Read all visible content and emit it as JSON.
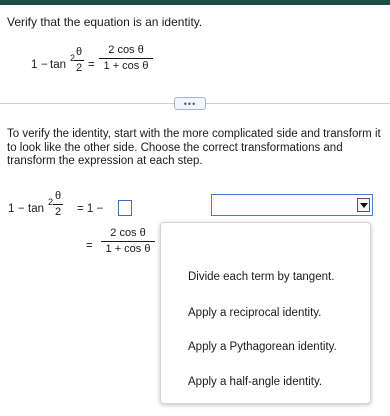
{
  "prompt": "Verify that the equation is an identity.",
  "equation": {
    "lhs_one": "1",
    "lhs_minus": "−",
    "lhs_tan": "tan",
    "lhs_exp": "2",
    "lhs_theta": "θ",
    "lhs_two": "2",
    "equals": "=",
    "rhs_num": "2 cos θ",
    "rhs_den": "1 + cos θ"
  },
  "more_button_label": "•••",
  "instructions": "To verify the identity, start with the more complicated side and transform it to look like the other side. Choose the correct transformations and transform the expression at each step.",
  "work": {
    "line1": {
      "one": "1",
      "minus": "−",
      "tan": "tan",
      "exp": "2",
      "theta": "θ",
      "two": "2",
      "equals_rhs": "= 1 −"
    },
    "line2": {
      "equals": "=",
      "num": "2 cos θ",
      "den": "1 + cos θ"
    }
  },
  "transformation_select": {
    "value": ""
  },
  "dropdown_options": [
    "Divide each term by tangent.",
    "Apply a reciprocal identity.",
    "Apply a Pythagorean identity.",
    "Apply a half-angle identity."
  ]
}
